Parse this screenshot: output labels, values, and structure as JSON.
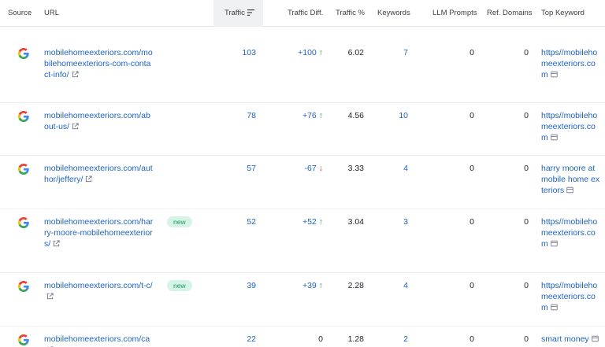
{
  "columns": {
    "source": "Source",
    "url": "URL",
    "traffic": "Traffic",
    "traffic_diff": "Traffic Diff.",
    "traffic_pct": "Traffic %",
    "keywords": "Keywords",
    "llm_prompts": "LLM Prompts",
    "ref_domains": "Ref. Domains",
    "top_keyword": "Top Keyword"
  },
  "rows": [
    {
      "url": "mobilehomeexteriors.com/mobilehomeexteriors-com-contact-info/",
      "badge": "",
      "traffic": "103",
      "diff": "+100",
      "diff_dir": "up",
      "pct": "6.02",
      "keywords": "7",
      "llm": "0",
      "ref": "0",
      "top_keyword": "https//mobilehomeexteriors.com"
    },
    {
      "url": "mobilehomeexteriors.com/about-us/",
      "badge": "",
      "traffic": "78",
      "diff": "+76",
      "diff_dir": "up",
      "pct": "4.56",
      "keywords": "10",
      "llm": "0",
      "ref": "0",
      "top_keyword": "https//mobilehomeexteriors.com"
    },
    {
      "url": "mobilehomeexteriors.com/author/jeffery/",
      "badge": "",
      "traffic": "57",
      "diff": "-67",
      "diff_dir": "down",
      "pct": "3.33",
      "keywords": "4",
      "llm": "0",
      "ref": "0",
      "top_keyword": "harry moore at mobile home exteriors"
    },
    {
      "url": "mobilehomeexteriors.com/harry-moore-mobilehomeexteriors/",
      "badge": "new",
      "traffic": "52",
      "diff": "+52",
      "diff_dir": "up",
      "pct": "3.04",
      "keywords": "3",
      "llm": "0",
      "ref": "0",
      "top_keyword": "https//mobilehomeexteriors.com"
    },
    {
      "url": "mobilehomeexteriors.com/t-c/",
      "badge": "new",
      "traffic": "39",
      "diff": "+39",
      "diff_dir": "up",
      "pct": "2.28",
      "keywords": "4",
      "llm": "0",
      "ref": "0",
      "top_keyword": "https//mobilehomeexteriors.com"
    },
    {
      "url": "mobilehomeexteriors.com/ca",
      "badge": "",
      "traffic": "22",
      "diff": "0",
      "diff_dir": "none",
      "pct": "1.28",
      "keywords": "2",
      "llm": "0",
      "ref": "0",
      "top_keyword": "smart money"
    }
  ],
  "colors": {
    "link": "#1d62c4",
    "up": "#139a5e",
    "down": "#d43a3a",
    "badge_bg": "#d5f4e6"
  },
  "icons": {
    "source": "google-icon",
    "url": "external-link-icon",
    "keyword": "serp-features-icon",
    "sort": "sort-descending-icon"
  }
}
